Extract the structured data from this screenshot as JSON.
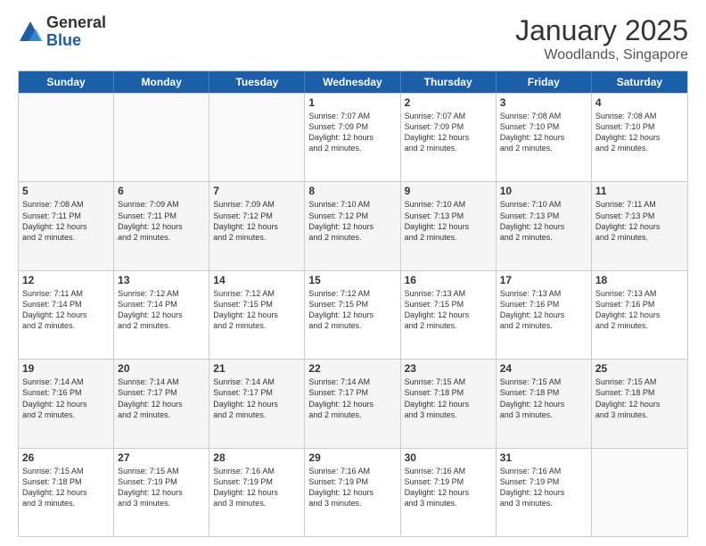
{
  "logo": {
    "general": "General",
    "blue": "Blue"
  },
  "title": {
    "month": "January 2025",
    "location": "Woodlands, Singapore"
  },
  "weekdays": [
    "Sunday",
    "Monday",
    "Tuesday",
    "Wednesday",
    "Thursday",
    "Friday",
    "Saturday"
  ],
  "rows": [
    {
      "shade": false,
      "cells": [
        {
          "day": "",
          "info": ""
        },
        {
          "day": "",
          "info": ""
        },
        {
          "day": "",
          "info": ""
        },
        {
          "day": "1",
          "info": "Sunrise: 7:07 AM\nSunset: 7:09 PM\nDaylight: 12 hours\nand 2 minutes."
        },
        {
          "day": "2",
          "info": "Sunrise: 7:07 AM\nSunset: 7:09 PM\nDaylight: 12 hours\nand 2 minutes."
        },
        {
          "day": "3",
          "info": "Sunrise: 7:08 AM\nSunset: 7:10 PM\nDaylight: 12 hours\nand 2 minutes."
        },
        {
          "day": "4",
          "info": "Sunrise: 7:08 AM\nSunset: 7:10 PM\nDaylight: 12 hours\nand 2 minutes."
        }
      ]
    },
    {
      "shade": true,
      "cells": [
        {
          "day": "5",
          "info": "Sunrise: 7:08 AM\nSunset: 7:11 PM\nDaylight: 12 hours\nand 2 minutes."
        },
        {
          "day": "6",
          "info": "Sunrise: 7:09 AM\nSunset: 7:11 PM\nDaylight: 12 hours\nand 2 minutes."
        },
        {
          "day": "7",
          "info": "Sunrise: 7:09 AM\nSunset: 7:12 PM\nDaylight: 12 hours\nand 2 minutes."
        },
        {
          "day": "8",
          "info": "Sunrise: 7:10 AM\nSunset: 7:12 PM\nDaylight: 12 hours\nand 2 minutes."
        },
        {
          "day": "9",
          "info": "Sunrise: 7:10 AM\nSunset: 7:13 PM\nDaylight: 12 hours\nand 2 minutes."
        },
        {
          "day": "10",
          "info": "Sunrise: 7:10 AM\nSunset: 7:13 PM\nDaylight: 12 hours\nand 2 minutes."
        },
        {
          "day": "11",
          "info": "Sunrise: 7:11 AM\nSunset: 7:13 PM\nDaylight: 12 hours\nand 2 minutes."
        }
      ]
    },
    {
      "shade": false,
      "cells": [
        {
          "day": "12",
          "info": "Sunrise: 7:11 AM\nSunset: 7:14 PM\nDaylight: 12 hours\nand 2 minutes."
        },
        {
          "day": "13",
          "info": "Sunrise: 7:12 AM\nSunset: 7:14 PM\nDaylight: 12 hours\nand 2 minutes."
        },
        {
          "day": "14",
          "info": "Sunrise: 7:12 AM\nSunset: 7:15 PM\nDaylight: 12 hours\nand 2 minutes."
        },
        {
          "day": "15",
          "info": "Sunrise: 7:12 AM\nSunset: 7:15 PM\nDaylight: 12 hours\nand 2 minutes."
        },
        {
          "day": "16",
          "info": "Sunrise: 7:13 AM\nSunset: 7:15 PM\nDaylight: 12 hours\nand 2 minutes."
        },
        {
          "day": "17",
          "info": "Sunrise: 7:13 AM\nSunset: 7:16 PM\nDaylight: 12 hours\nand 2 minutes."
        },
        {
          "day": "18",
          "info": "Sunrise: 7:13 AM\nSunset: 7:16 PM\nDaylight: 12 hours\nand 2 minutes."
        }
      ]
    },
    {
      "shade": true,
      "cells": [
        {
          "day": "19",
          "info": "Sunrise: 7:14 AM\nSunset: 7:16 PM\nDaylight: 12 hours\nand 2 minutes."
        },
        {
          "day": "20",
          "info": "Sunrise: 7:14 AM\nSunset: 7:17 PM\nDaylight: 12 hours\nand 2 minutes."
        },
        {
          "day": "21",
          "info": "Sunrise: 7:14 AM\nSunset: 7:17 PM\nDaylight: 12 hours\nand 2 minutes."
        },
        {
          "day": "22",
          "info": "Sunrise: 7:14 AM\nSunset: 7:17 PM\nDaylight: 12 hours\nand 2 minutes."
        },
        {
          "day": "23",
          "info": "Sunrise: 7:15 AM\nSunset: 7:18 PM\nDaylight: 12 hours\nand 3 minutes."
        },
        {
          "day": "24",
          "info": "Sunrise: 7:15 AM\nSunset: 7:18 PM\nDaylight: 12 hours\nand 3 minutes."
        },
        {
          "day": "25",
          "info": "Sunrise: 7:15 AM\nSunset: 7:18 PM\nDaylight: 12 hours\nand 3 minutes."
        }
      ]
    },
    {
      "shade": false,
      "cells": [
        {
          "day": "26",
          "info": "Sunrise: 7:15 AM\nSunset: 7:18 PM\nDaylight: 12 hours\nand 3 minutes."
        },
        {
          "day": "27",
          "info": "Sunrise: 7:15 AM\nSunset: 7:19 PM\nDaylight: 12 hours\nand 3 minutes."
        },
        {
          "day": "28",
          "info": "Sunrise: 7:16 AM\nSunset: 7:19 PM\nDaylight: 12 hours\nand 3 minutes."
        },
        {
          "day": "29",
          "info": "Sunrise: 7:16 AM\nSunset: 7:19 PM\nDaylight: 12 hours\nand 3 minutes."
        },
        {
          "day": "30",
          "info": "Sunrise: 7:16 AM\nSunset: 7:19 PM\nDaylight: 12 hours\nand 3 minutes."
        },
        {
          "day": "31",
          "info": "Sunrise: 7:16 AM\nSunset: 7:19 PM\nDaylight: 12 hours\nand 3 minutes."
        },
        {
          "day": "",
          "info": ""
        }
      ]
    }
  ]
}
